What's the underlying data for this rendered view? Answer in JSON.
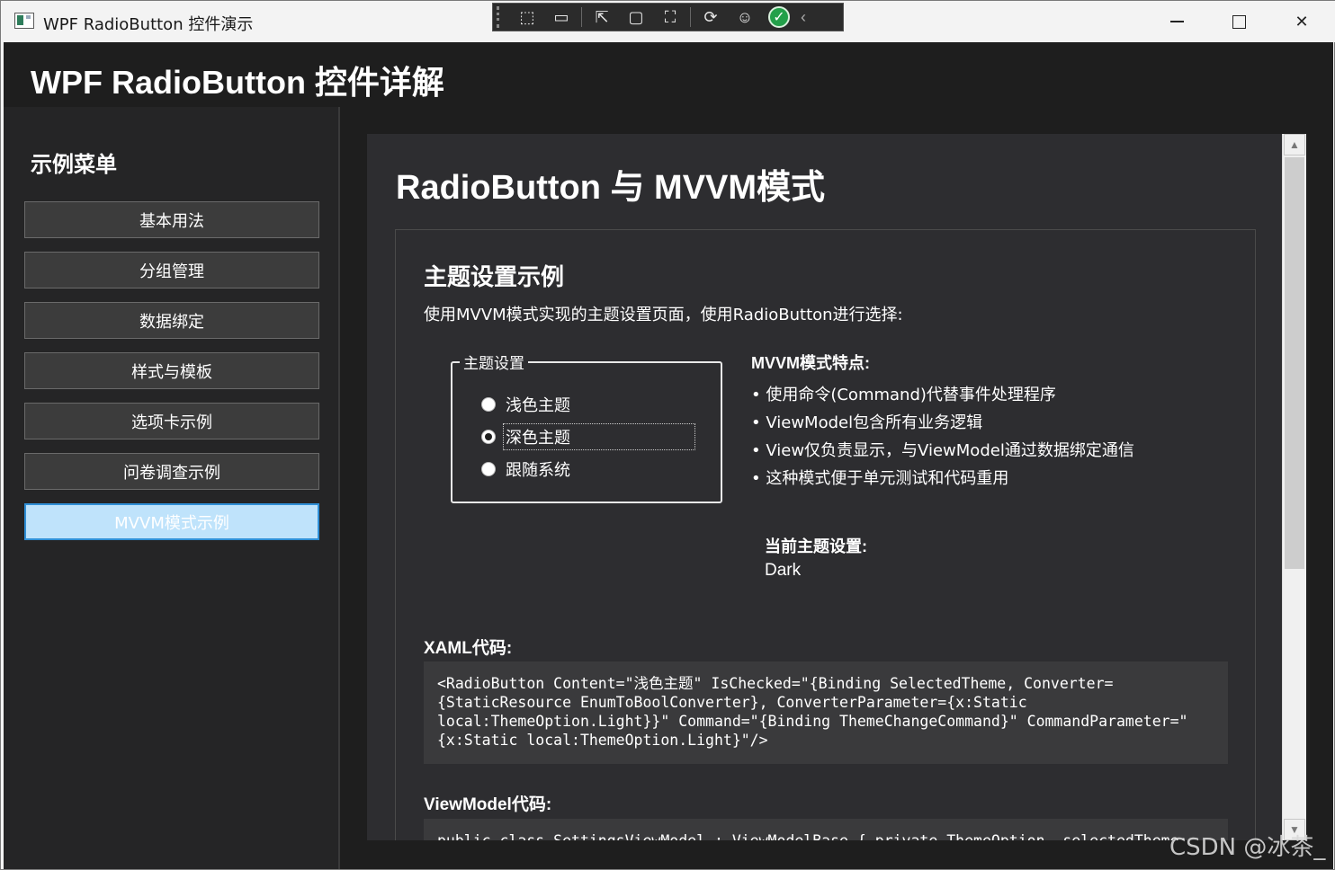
{
  "window": {
    "title": "WPF RadioButton 控件演示",
    "controls": {
      "minimize": "—",
      "close": "✕"
    }
  },
  "devtools": {
    "icons": [
      "select-element-icon",
      "video-icon",
      "cursor-icon",
      "layout-adorner-icon",
      "track-focus-icon",
      "hot-reload-icon",
      "accessibility-icon",
      "checkmark-icon",
      "collapse-icon"
    ],
    "glyphs": {
      "select": "⬚",
      "video": "▭",
      "cursor": "⇱",
      "adorner": "▢",
      "focus": "⛶",
      "reload": "⟳",
      "accessibility": "☺",
      "check": "✓",
      "collapse": "‹"
    }
  },
  "header": {
    "title": "WPF RadioButton 控件详解"
  },
  "sidebar": {
    "title": "示例菜单",
    "items": [
      {
        "label": "基本用法"
      },
      {
        "label": "分组管理"
      },
      {
        "label": "数据绑定"
      },
      {
        "label": "样式与模板"
      },
      {
        "label": "选项卡示例"
      },
      {
        "label": "问卷调查示例"
      },
      {
        "label": "MVVM模式示例"
      }
    ],
    "active_index": 6
  },
  "main": {
    "title": "RadioButton 与 MVVM模式",
    "card": {
      "title": "主题设置示例",
      "description": "使用MVVM模式实现的主题设置页面，使用RadioButton进行选择:",
      "group": {
        "legend": "主题设置",
        "options": [
          {
            "label": "浅色主题",
            "checked": false
          },
          {
            "label": "深色主题",
            "checked": true
          },
          {
            "label": "跟随系统",
            "checked": false
          }
        ]
      },
      "features_title": "MVVM模式特点:",
      "features": [
        "使用命令(Command)代替事件处理程序",
        "ViewModel包含所有业务逻辑",
        "View仅负责显示，与ViewModel通过数据绑定通信",
        "这种模式便于单元测试和代码重用"
      ],
      "current_label": "当前主题设置:",
      "current_value": "Dark",
      "xaml_title": "XAML代码:",
      "xaml_code": "<RadioButton Content=\"浅色主题\" IsChecked=\"{Binding SelectedTheme, Converter={StaticResource EnumToBoolConverter}, ConverterParameter={x:Static local:ThemeOption.Light}}\" Command=\"{Binding ThemeChangeCommand}\" CommandParameter=\"{x:Static local:ThemeOption.Light}\"/>",
      "vm_title": "ViewModel代码:",
      "vm_code": "public class SettingsViewModel : ViewModelBase { private ThemeOption _selectedTheme;"
    }
  },
  "scrollbar": {
    "up": "▲",
    "down": "▼"
  },
  "watermark": "CSDN @冰茶_",
  "colors": {
    "background": "#1e1e1e",
    "sidebar": "#252526",
    "panel": "#2d2d30",
    "active_button": "#bfe3fb",
    "success": "#23a04a"
  }
}
